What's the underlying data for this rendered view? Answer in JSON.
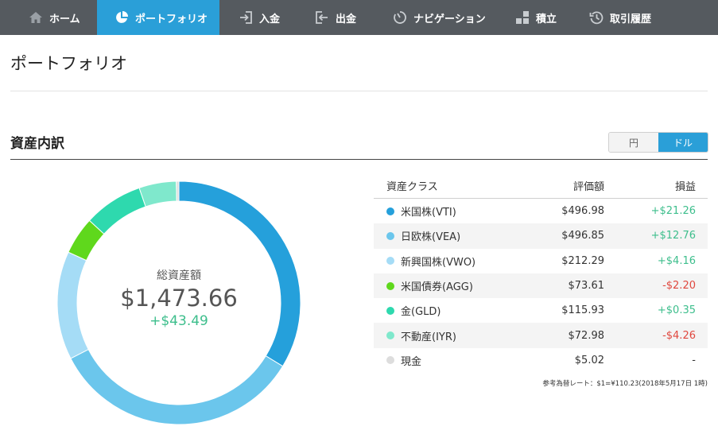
{
  "nav": {
    "items": [
      {
        "label": "ホーム",
        "icon": "home-icon",
        "active": false
      },
      {
        "label": "ポートフォリオ",
        "icon": "pie-chart-icon",
        "active": true
      },
      {
        "label": "入金",
        "icon": "deposit-icon",
        "active": false
      },
      {
        "label": "出金",
        "icon": "withdraw-icon",
        "active": false
      },
      {
        "label": "ナビゲーション",
        "icon": "navigation-icon",
        "active": false
      },
      {
        "label": "積立",
        "icon": "blocks-icon",
        "active": false
      },
      {
        "label": "取引履歴",
        "icon": "history-icon",
        "active": false
      }
    ]
  },
  "page": {
    "title": "ポートフォリオ"
  },
  "section": {
    "title": "資産内訳"
  },
  "currency_toggle": {
    "yen": "円",
    "dollar": "ドル",
    "selected": "ドル"
  },
  "summary": {
    "label": "総資産額",
    "total": "$1,473.66",
    "change": "+$43.49"
  },
  "table": {
    "headers": {
      "asset_class": "資産クラス",
      "value": "評価額",
      "pnl": "損益"
    },
    "rows": [
      {
        "name": "米国株(VTI)",
        "value": "$496.98",
        "pnl": "+$21.26",
        "color": "#25a0db",
        "sign": "pos"
      },
      {
        "name": "日欧株(VEA)",
        "value": "$496.85",
        "pnl": "+$12.76",
        "color": "#6bc6ec",
        "sign": "pos"
      },
      {
        "name": "新興国株(VWO)",
        "value": "$212.29",
        "pnl": "+$4.16",
        "color": "#a5dcf6",
        "sign": "pos"
      },
      {
        "name": "米国債券(AGG)",
        "value": "$73.61",
        "pnl": "-$2.20",
        "color": "#5fd81c",
        "sign": "neg"
      },
      {
        "name": "金(GLD)",
        "value": "$115.93",
        "pnl": "+$0.35",
        "color": "#2ed9ae",
        "sign": "pos"
      },
      {
        "name": "不動産(IYR)",
        "value": "$72.98",
        "pnl": "-$4.26",
        "color": "#7fe8cc",
        "sign": "neg"
      },
      {
        "name": "現金",
        "value": "$5.02",
        "pnl": "-",
        "color": "#dddddd",
        "sign": "neu"
      }
    ]
  },
  "footnote": "参考為替レート：$1=¥110.23(2018年5月17日 1時)",
  "chart_data": {
    "type": "pie",
    "categories": [
      "米国株(VTI)",
      "日欧株(VEA)",
      "新興国株(VWO)",
      "米国債券(AGG)",
      "金(GLD)",
      "不動産(IYR)",
      "現金"
    ],
    "values": [
      496.98,
      496.85,
      212.29,
      73.61,
      115.93,
      72.98,
      5.02
    ],
    "colors": [
      "#25a0db",
      "#6bc6ec",
      "#a5dcf6",
      "#5fd81c",
      "#2ed9ae",
      "#7fe8cc",
      "#dddddd"
    ]
  }
}
